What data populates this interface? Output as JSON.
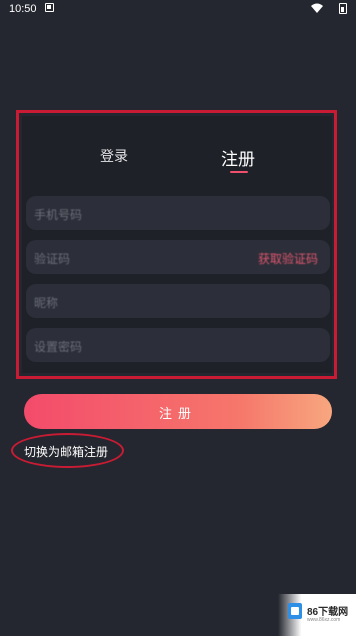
{
  "status_bar": {
    "time": "10:50"
  },
  "tabs": {
    "login": "登录",
    "register": "注册"
  },
  "form": {
    "phone_placeholder": "手机号码",
    "code_placeholder": "验证码",
    "get_code": "获取验证码",
    "nickname_placeholder": "昵称",
    "password_placeholder": "设置密码"
  },
  "register_button": "注册",
  "switch_email": "切换为邮箱注册",
  "watermark": {
    "brand": "86下载网",
    "domain": "www.86xz.com"
  },
  "colors": {
    "background": "#24272f",
    "accent": "#f34b6b",
    "annotation": "#c91c34"
  }
}
